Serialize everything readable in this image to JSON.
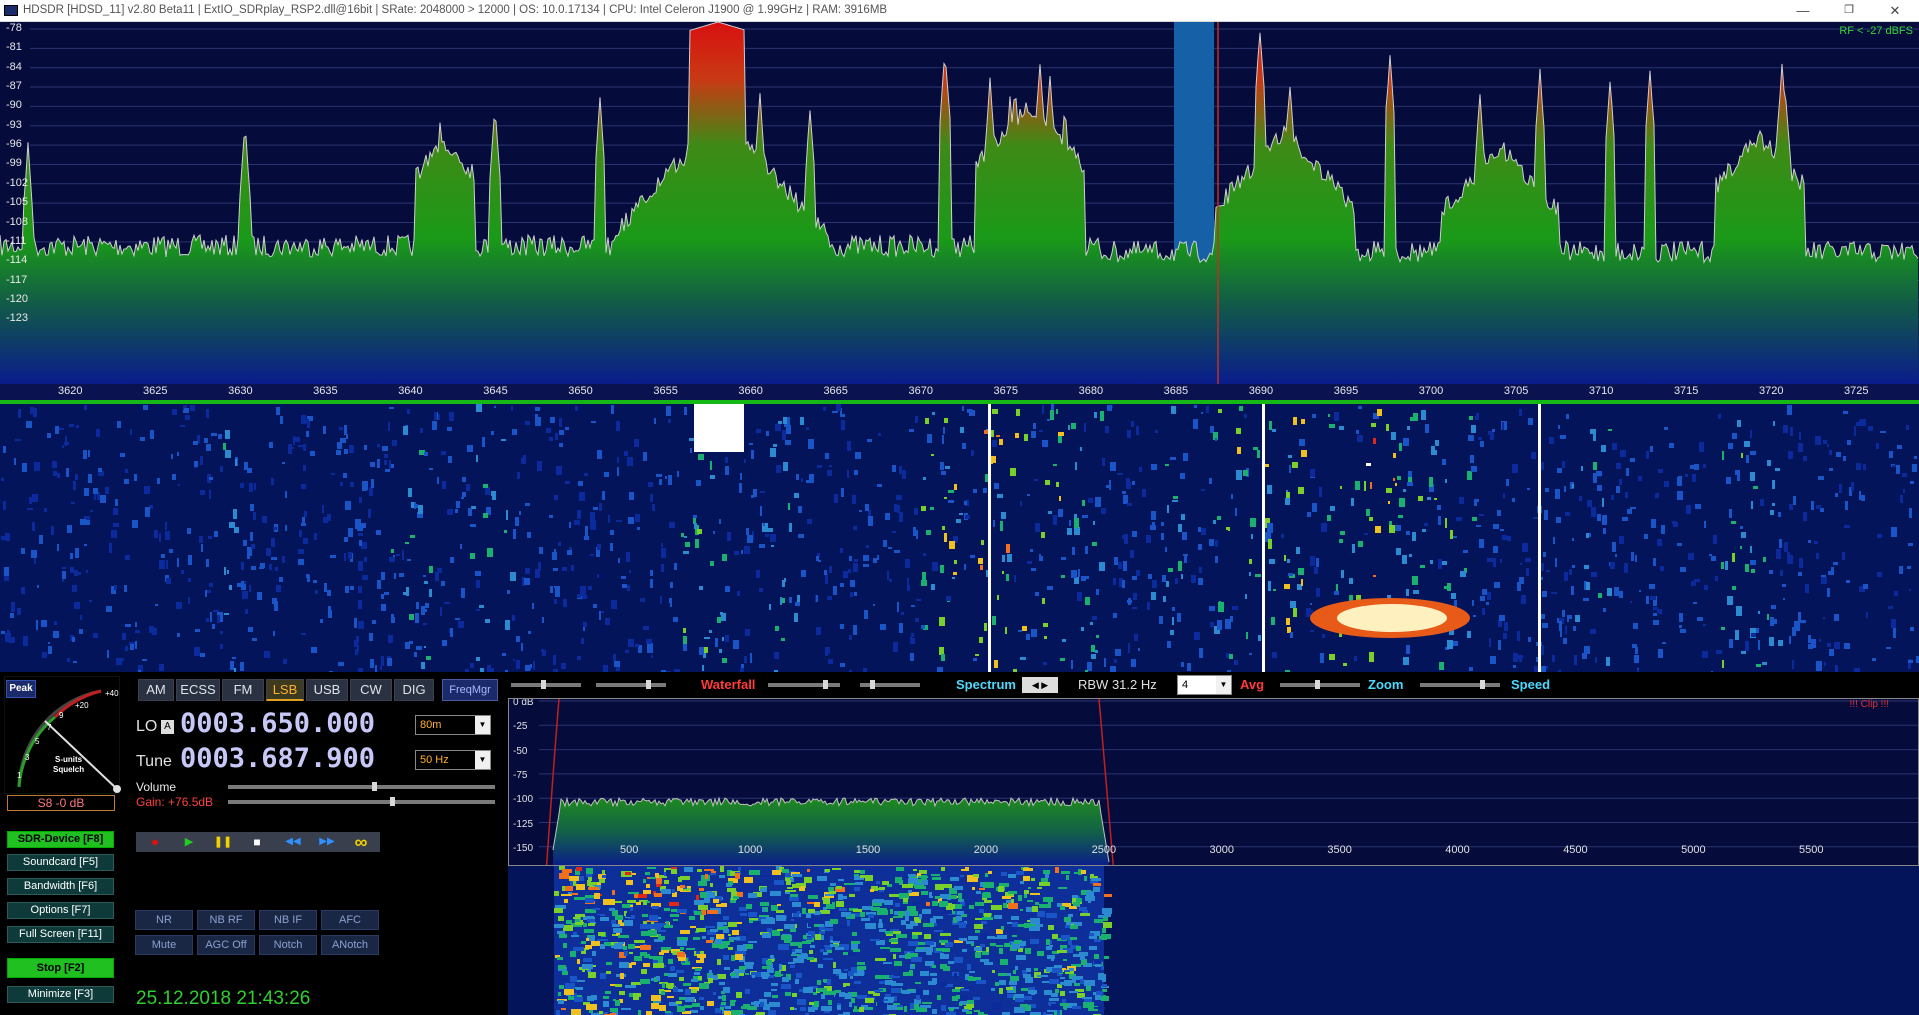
{
  "window": {
    "title": "HDSDR  [HDSD_11]  v2.80 Beta11  |  ExtIO_SDRplay_RSP2.dll@16bit  |  SRate: 2048000 > 12000  |  OS: 10.0.17134  |  CPU: Intel Celeron  J1900  @ 1.99GHz  |  RAM: 3916MB",
    "minimize_glyph": "—",
    "restore_glyph": "❐",
    "close_glyph": "✕"
  },
  "spectrum": {
    "rf_info": "RF < -27 dBFS",
    "db_labels": [
      "-78",
      "-81",
      "-84",
      "-87",
      "-90",
      "-93",
      "-96",
      "-99",
      "-102",
      "-105",
      "-108",
      "-111",
      "-114",
      "-117",
      "-120",
      "-123"
    ],
    "freq_labels": [
      "3620",
      "3625",
      "3630",
      "3635",
      "3640",
      "3645",
      "3650",
      "3655",
      "3660",
      "3665",
      "3670",
      "3675",
      "3680",
      "3685",
      "3690",
      "3695",
      "3700",
      "3705",
      "3710",
      "3715",
      "3720",
      "3725"
    ]
  },
  "smeter": {
    "peak_label": "Peak",
    "scale": [
      "1",
      "3",
      "5",
      "7",
      "9",
      "+20",
      "+40"
    ],
    "caption_line1": "S-units",
    "caption_line2": "Squelch",
    "reading": "S8 -0 dB"
  },
  "sidebar": {
    "buttons": [
      {
        "label": "SDR-Device  [F8]",
        "active": true
      },
      {
        "label": "Soundcard  [F5]",
        "active": false
      },
      {
        "label": "Bandwidth  [F6]",
        "active": false
      },
      {
        "label": "Options  [F7]",
        "active": false
      },
      {
        "label": "Full Screen  [F11]",
        "active": false
      }
    ],
    "stop": "Stop  [F2]",
    "minimize": "Minimize  [F3]"
  },
  "modes": {
    "buttons": [
      "AM",
      "ECSS",
      "FM",
      "LSB",
      "USB",
      "CW",
      "DIG"
    ],
    "active": "LSB",
    "freqmgr": "FreqMgr"
  },
  "lo": {
    "label": "LO",
    "badge": "A",
    "value": "0003.650.000",
    "band": "80m"
  },
  "tune": {
    "label": "Tune",
    "value": "0003.687.900",
    "step": "50 Hz"
  },
  "volume": {
    "label": "Volume",
    "level": 0.55
  },
  "gain": {
    "label": "Gain: +76.5dB",
    "level": 0.62
  },
  "transport": {
    "record": "●",
    "play": "▶",
    "pause": "❚❚",
    "stop": "■",
    "rewind": "◀◀",
    "forward": "▶▶",
    "loop": "∞"
  },
  "dsp": {
    "row1": [
      "NR",
      "NB RF",
      "NB IF",
      "AFC"
    ],
    "row2": [
      "Mute",
      "AGC Off",
      "Notch",
      "ANotch"
    ]
  },
  "clock": "25.12.2018 21:43:26",
  "control_bar": {
    "waterfall": "Waterfall",
    "spectrum": "Spectrum",
    "rbw": "RBW 31.2 Hz",
    "avg_value": "4",
    "avg": "Avg",
    "zoom": "Zoom",
    "speed": "Speed"
  },
  "audio": {
    "clip": "!!! Clip !!!",
    "db_labels": [
      "0 dB",
      "-25",
      "-50",
      "-75",
      "-100",
      "-125",
      "-150"
    ],
    "freq_labels": [
      "500",
      "1000",
      "1500",
      "2000",
      "2500",
      "3000",
      "3500",
      "4000",
      "4500",
      "5000",
      "5500"
    ]
  },
  "colors": {
    "accent_green": "#2fd02f",
    "waterfall_label": "#ff3b3b",
    "spectrum_label": "#4fd8ff",
    "lsb_active": "#ffb030",
    "freq_digits": "#c8c8f8"
  }
}
